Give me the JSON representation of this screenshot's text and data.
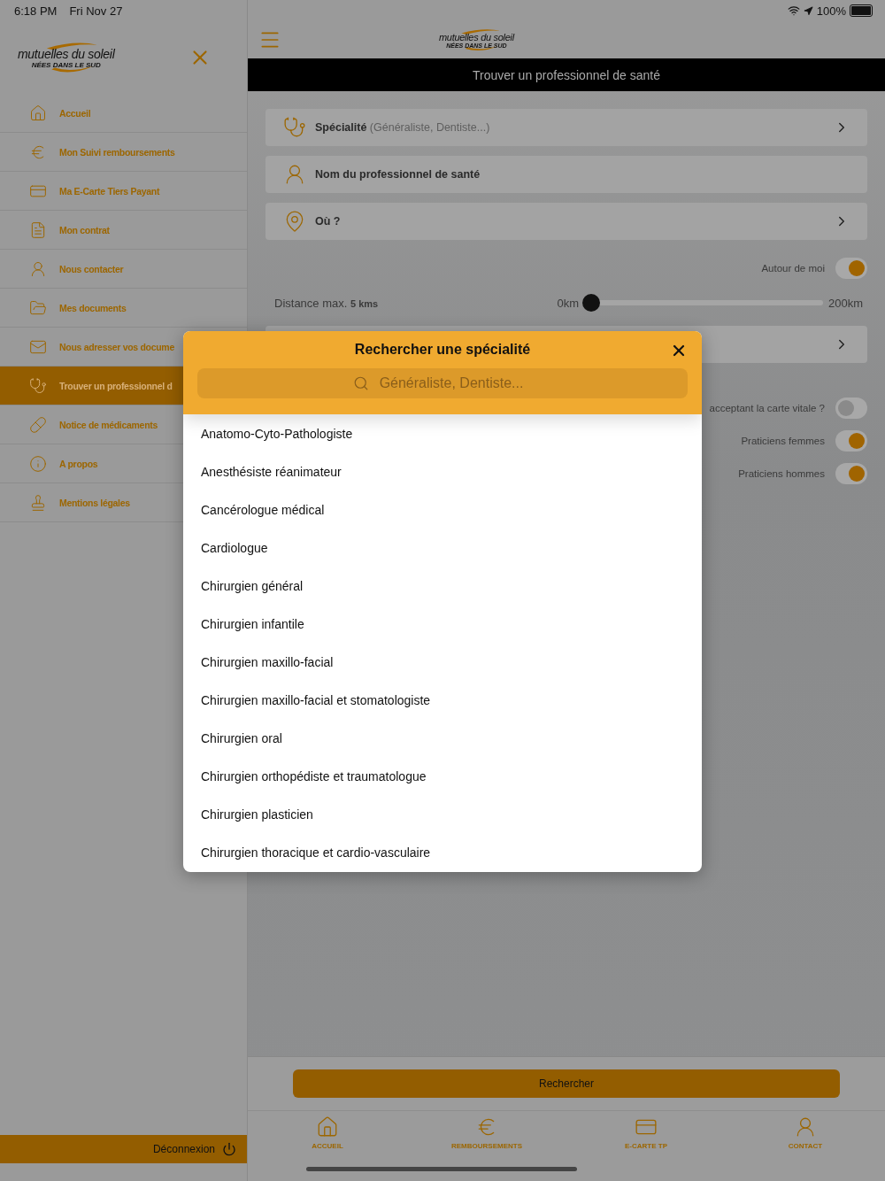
{
  "status_bar": {
    "time": "6:18 PM",
    "date": "Fri Nov 27",
    "battery": "100%"
  },
  "sidebar": {
    "logo": {
      "name": "mutuelles du soleil",
      "tagline": "NÉES DANS LE SUD"
    },
    "items": [
      {
        "label": "Accueil",
        "selected": false
      },
      {
        "label": "Mon Suivi remboursements",
        "selected": false
      },
      {
        "label": "Ma E-Carte Tiers Payant",
        "selected": false
      },
      {
        "label": "Mon contrat",
        "selected": false
      },
      {
        "label": "Nous contacter",
        "selected": false
      },
      {
        "label": "Mes documents",
        "selected": false
      },
      {
        "label": "Nous adresser vos docume",
        "selected": false
      },
      {
        "label": "Trouver un professionnel d",
        "selected": true
      },
      {
        "label": "Notice de médicaments",
        "selected": false
      },
      {
        "label": "A propos",
        "selected": false
      },
      {
        "label": "Mentions légales",
        "selected": false
      }
    ],
    "logout": "Déconnexion"
  },
  "header": {
    "logo": {
      "name": "mutuelles du soleil",
      "tagline": "NÉES DANS LE SUD"
    },
    "title": "Trouver un professionnel de santé"
  },
  "search_rows": [
    {
      "label": "Spécialité",
      "hint": "(Généraliste, Dentiste...)",
      "chevron": true
    },
    {
      "label": "Nom du professionnel de santé",
      "chevron": false
    },
    {
      "label": "Où ?",
      "chevron": true
    }
  ],
  "nearby_toggle": {
    "label": "Autour de moi",
    "on": true
  },
  "distance": {
    "label": "Distance max.",
    "value": "5 kms",
    "min": "0km",
    "max": "200km",
    "level": 0
  },
  "toggles": [
    {
      "label": "acceptant la carte vitale ?",
      "on": false
    },
    {
      "label": "Praticiens femmes",
      "on": true
    },
    {
      "label": "Praticiens hommes",
      "on": true
    }
  ],
  "modal": {
    "title": "Rechercher une spécialité",
    "placeholder": "Généraliste, Dentiste...",
    "items": [
      "Anatomo-Cyto-Pathologiste",
      "Anesthésiste réanimateur",
      "Cancérologue médical",
      "Cardiologue",
      "Chirurgien général",
      "Chirurgien infantile",
      "Chirurgien maxillo-facial",
      "Chirurgien maxillo-facial et stomatologiste",
      "Chirurgien oral",
      "Chirurgien orthopédiste et traumatologue",
      "Chirurgien plasticien",
      "Chirurgien thoracique et cardio-vasculaire"
    ]
  },
  "search_button": "Rechercher",
  "tab_bar": [
    "ACCUEIL",
    "REMBOURSEMENTS",
    "E-CARTE TP",
    "CONTACT"
  ]
}
